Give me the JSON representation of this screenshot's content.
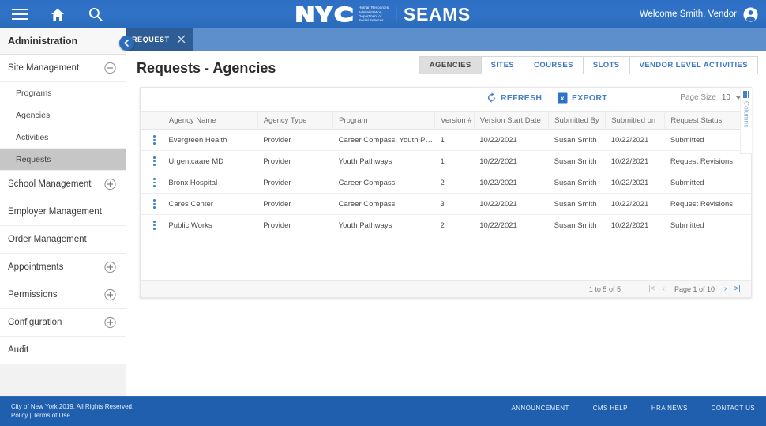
{
  "colors": {
    "brand_blue": "#2d6fc4",
    "footer_blue": "#1f5fad",
    "tab_strip": "#5d8fcd",
    "active_tab": "#2e5d96",
    "link_blue": "#4680c9",
    "selected_row": "#c6c6c6"
  },
  "topbar": {
    "menu_icon": "hamburger-icon",
    "home_icon": "home-icon",
    "search_icon": "search-icon",
    "logo_text": "NYC",
    "agency_lines": [
      "Human Resources",
      "Administration",
      "Department of",
      "Social Services"
    ],
    "app_name": "SEAMS",
    "welcome_text": "Welcome Smith, Vendor",
    "avatar_icon": "account-circle-icon"
  },
  "document_tab": {
    "label": "REQUEST",
    "close_icon": "close-icon"
  },
  "sidebar": {
    "title": "Administration",
    "collapse_icon": "chevron-left-icon",
    "items": [
      {
        "label": "Site Management",
        "type": "group",
        "expander": "minus-circle-icon",
        "expanded": true
      },
      {
        "label": "Programs",
        "type": "sub",
        "active": false
      },
      {
        "label": "Agencies",
        "type": "sub",
        "active": false
      },
      {
        "label": "Activities",
        "type": "sub",
        "active": false
      },
      {
        "label": "Requests",
        "type": "sub",
        "active": true
      },
      {
        "label": "School Management",
        "type": "group",
        "expander": "plus-circle-icon",
        "expanded": false
      },
      {
        "label": "Employer Management",
        "type": "group",
        "expander": null,
        "expanded": false
      },
      {
        "label": "Order Management",
        "type": "group",
        "expander": null,
        "expanded": false
      },
      {
        "label": "Appointments",
        "type": "group",
        "expander": "plus-circle-icon",
        "expanded": false
      },
      {
        "label": "Permissions",
        "type": "group",
        "expander": "plus-circle-icon",
        "expanded": false
      },
      {
        "label": "Configuration",
        "type": "group",
        "expander": "plus-circle-icon",
        "expanded": false
      },
      {
        "label": "Audit",
        "type": "group",
        "expander": null,
        "expanded": false
      }
    ]
  },
  "main": {
    "page_title": "Requests - Agencies",
    "segmented_tabs": [
      {
        "label": "AGENCIES",
        "active": true
      },
      {
        "label": "SITES",
        "active": false
      },
      {
        "label": "COURSES",
        "active": false
      },
      {
        "label": "SLOTS",
        "active": false
      },
      {
        "label": "VENDOR LEVEL ACTIVITIES",
        "active": false
      }
    ],
    "toolbar": {
      "refresh_label": "REFRESH",
      "refresh_icon": "refresh-icon",
      "export_label": "EXPORT",
      "export_icon": "excel-file-icon",
      "page_size_label": "Page Size",
      "page_size_value": "10"
    },
    "columns_panel": {
      "label": "Columns",
      "icon": "columns-bars-icon"
    },
    "grid": {
      "row_menu_icon": "kebab-menu-icon",
      "headers": [
        "Agency Name",
        "Agency Type",
        "Program",
        "Version #",
        "Version Start Date",
        "Submitted By",
        "Submitted on",
        "Request Status"
      ],
      "rows": [
        {
          "agency_name": "Evergreen Health",
          "agency_type": "Provider",
          "program": "Career Compass, Youth Pathways",
          "version": "1",
          "version_start_date": "10/22/2021",
          "submitted_by": "Susan Smith",
          "submitted_on": "10/22/2021",
          "request_status": "Submitted"
        },
        {
          "agency_name": "Urgentcaare MD",
          "agency_type": "Provider",
          "program": "Youth Pathways",
          "version": "1",
          "version_start_date": "10/22/2021",
          "submitted_by": "Susan Smith",
          "submitted_on": "10/22/2021",
          "request_status": "Request Revisions"
        },
        {
          "agency_name": "Bronx Hospital",
          "agency_type": "Provider",
          "program": "Career Compass",
          "version": "2",
          "version_start_date": "10/22/2021",
          "submitted_by": "Susan Smith",
          "submitted_on": "10/22/2021",
          "request_status": "Submitted"
        },
        {
          "agency_name": "Cares Center",
          "agency_type": "Provider",
          "program": "Career Compass",
          "version": "3",
          "version_start_date": "10/22/2021",
          "submitted_by": "Susan Smith",
          "submitted_on": "10/22/2021",
          "request_status": "Request Revisions"
        },
        {
          "agency_name": "Public Works",
          "agency_type": "Provider",
          "program": "Youth Pathways",
          "version": "2",
          "version_start_date": "10/22/2021",
          "submitted_by": "Susan Smith",
          "submitted_on": "10/22/2021",
          "request_status": "Submitted"
        }
      ],
      "pagination": {
        "range_text": "1 to 5 of 5",
        "first_icon": "|<",
        "prev_icon": "‹",
        "page_text": "Page 1 of 10",
        "next_icon": "›",
        "last_icon": ">|"
      }
    }
  },
  "footer": {
    "copyright": "City of New York 2019. All Rights Reserved.",
    "policy_label": "Policy",
    "separator": "|",
    "terms_label": "Terms of Use",
    "links": [
      "ANNOUNCEMENT",
      "CMS HELP",
      "HRA NEWS",
      "CONTACT US"
    ]
  }
}
